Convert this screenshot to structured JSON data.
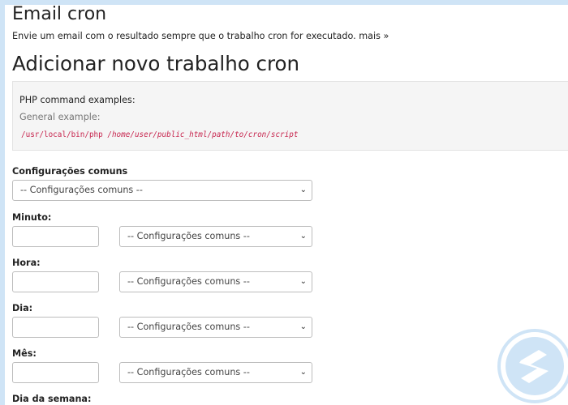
{
  "email_section": {
    "title": "Email cron",
    "description": "Envie um email com o resultado sempre que o trabalho cron for executado.",
    "more_link": "mais »"
  },
  "add_section": {
    "title": "Adicionar novo trabalho cron"
  },
  "php_examples": {
    "title": "PHP command examples:",
    "subtitle": "General example:",
    "command_path": "/usr/local/bin/php ",
    "command_arg": "/home/user/public_html/path/to/cron/script"
  },
  "common_settings": {
    "label": "Configurações comuns",
    "value": "-- Configurações comuns --"
  },
  "fields": {
    "minute": {
      "label": "Minuto:",
      "value": "",
      "select": "-- Configurações comuns --"
    },
    "hour": {
      "label": "Hora:",
      "value": "",
      "select": "-- Configurações comuns --"
    },
    "day": {
      "label": "Dia:",
      "value": "",
      "select": "-- Configurações comuns --"
    },
    "month": {
      "label": "Mês:",
      "value": "",
      "select": "-- Configurações comuns --"
    },
    "weekday": {
      "label": "Dia da semana:"
    }
  },
  "icons": {
    "dropdown": "chevron-down-icon",
    "logo": "brand-logo"
  },
  "colors": {
    "frame": "#cfe4f6",
    "code": "#c7254e",
    "logo": "#cfe4f6"
  }
}
